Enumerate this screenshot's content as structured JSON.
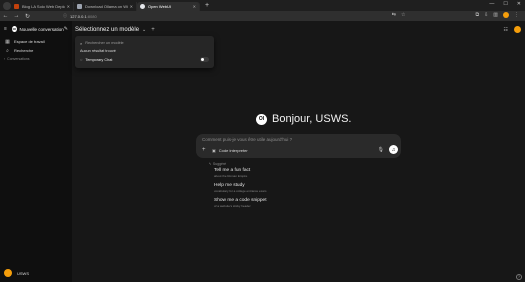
{
  "browser": {
    "tabs": [
      {
        "title": "Blog LA Solo Web Deployment",
        "favicon_color": "#c2410c"
      },
      {
        "title": "Download Ollama on Windows",
        "favicon_color": "#9ca3af"
      },
      {
        "title": "Open WebUI",
        "favicon_color": "#e5e7eb"
      }
    ],
    "active_tab": 2,
    "url_host": "127.0.0.1",
    "url_path": ":8080"
  },
  "sidebar": {
    "title": "Nouvelle conversation",
    "items": [
      {
        "label": "Espace de travail",
        "icon": "workspace-icon"
      },
      {
        "label": "Recherche",
        "icon": "search-icon"
      }
    ],
    "section_label": "Conversations",
    "user": "USWS"
  },
  "main": {
    "model_selector_label": "Sélectionnez un modèle",
    "dropdown": {
      "search_placeholder": "Rechercher un modèle",
      "no_results": "Aucun résultat trouvé",
      "temporary_chat_label": "Temporary Chat",
      "temporary_chat_enabled": false
    },
    "greeting": "Bonjour, USWS.",
    "logo_text": "OI",
    "chat_placeholder": "Comment puis-je vous être utile aujourd'hui ?",
    "tool_label": "Code interpreter",
    "suggested_header": "Suggéré",
    "suggestions": [
      {
        "title": "Tell me a fun fact",
        "subtitle": "about the Roman Empire"
      },
      {
        "title": "Help me study",
        "subtitle": "vocabulary for a college entrance exam"
      },
      {
        "title": "Show me a code snippet",
        "subtitle": "of a website's sticky header"
      }
    ]
  }
}
